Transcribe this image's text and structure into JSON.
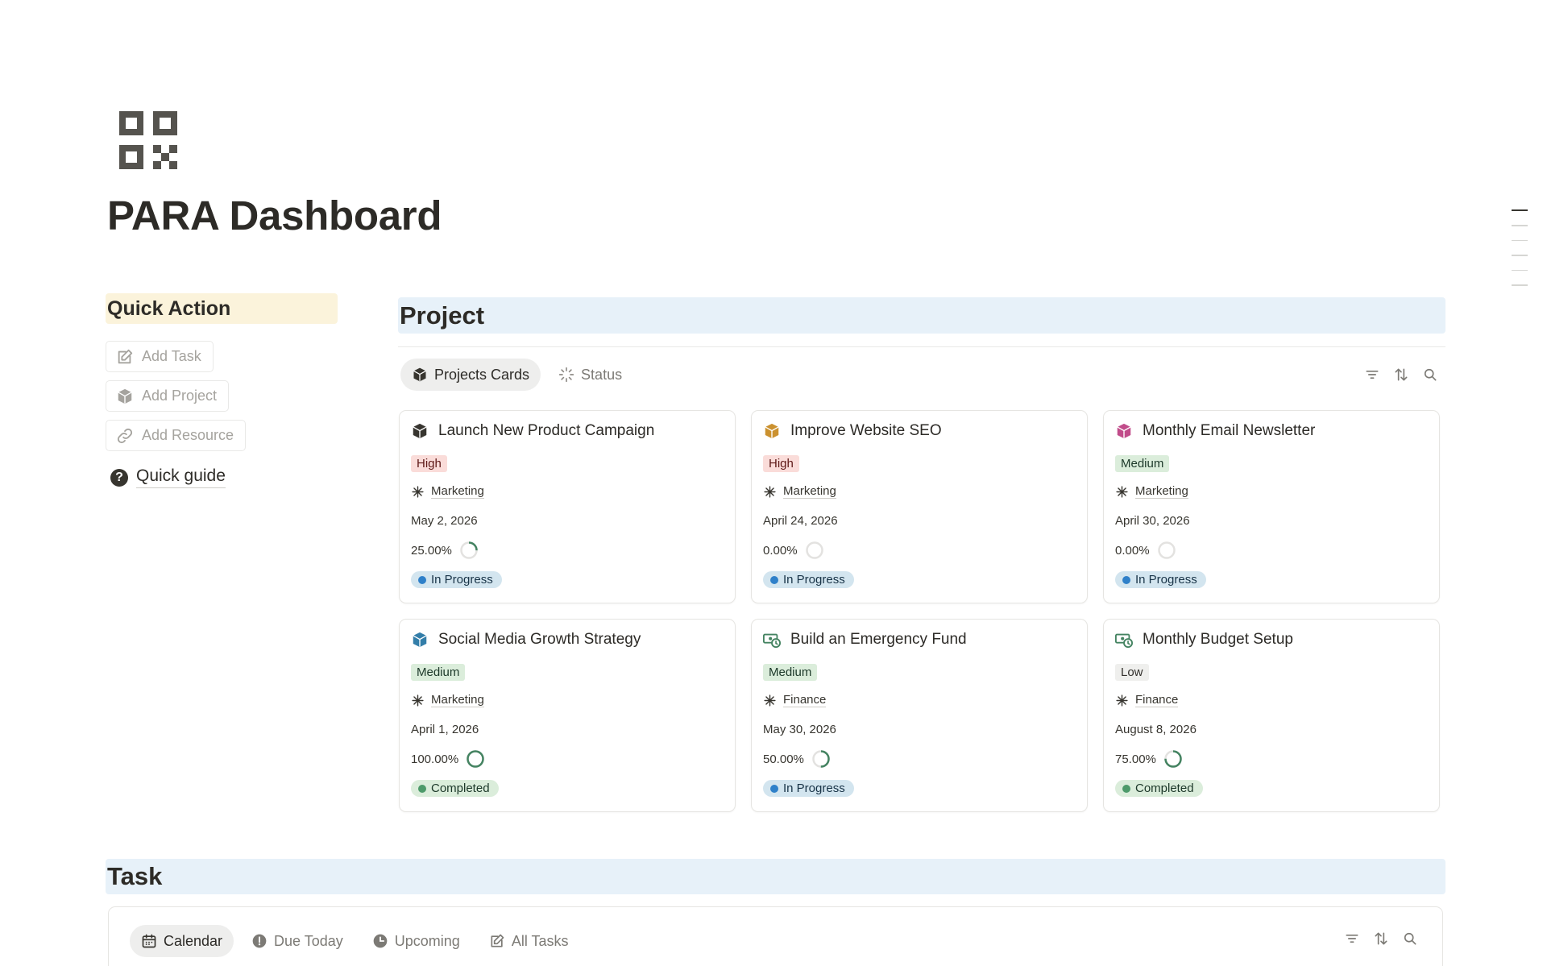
{
  "page": {
    "title": "PARA Dashboard",
    "icon": "qr-code-icon"
  },
  "quick_action": {
    "heading": "Quick Action",
    "buttons": [
      {
        "label": "Add Task",
        "icon": "edit-icon"
      },
      {
        "label": "Add Project",
        "icon": "cube-icon"
      },
      {
        "label": "Add Resource",
        "icon": "link-icon"
      }
    ],
    "guide": {
      "label": "Quick guide",
      "icon": "question-circle-icon"
    }
  },
  "project": {
    "heading": "Project",
    "tabs": [
      {
        "label": "Projects Cards",
        "icon": "cube-icon",
        "active": true
      },
      {
        "label": "Status",
        "icon": "loading-icon",
        "active": false
      }
    ],
    "tools": [
      "filter-icon",
      "sort-icon",
      "search-icon"
    ],
    "cards": [
      {
        "title": "Launch New Product Campaign",
        "icon_color": "#37352f",
        "priority": "High",
        "area": "Marketing",
        "date": "May 2, 2026",
        "progress": "25.00%",
        "progress_value": 0.25,
        "status": "In Progress"
      },
      {
        "title": "Improve Website SEO",
        "icon_color": "#cb912f",
        "priority": "High",
        "area": "Marketing",
        "date": "April 24, 2026",
        "progress": "0.00%",
        "progress_value": 0,
        "status": "In Progress"
      },
      {
        "title": "Monthly Email Newsletter",
        "icon_color": "#c14c8a",
        "priority": "Medium",
        "area": "Marketing",
        "date": "April 30, 2026",
        "progress": "0.00%",
        "progress_value": 0,
        "status": "In Progress"
      },
      {
        "title": "Social Media Growth Strategy",
        "icon_color": "#337ea9",
        "priority": "Medium",
        "area": "Marketing",
        "date": "April 1, 2026",
        "progress": "100.00%",
        "progress_value": 1,
        "status": "Completed"
      },
      {
        "title": "Build an Emergency Fund",
        "icon_color": "#448361",
        "priority": "Medium",
        "area": "Finance",
        "date": "May 30, 2026",
        "progress": "50.00%",
        "progress_value": 0.5,
        "status": "In Progress"
      },
      {
        "title": "Monthly Budget Setup",
        "icon_color": "#448361",
        "priority": "Low",
        "area": "Finance",
        "date": "August 8, 2026",
        "progress": "75.00%",
        "progress_value": 0.75,
        "status": "Completed"
      }
    ]
  },
  "task": {
    "heading": "Task",
    "tabs": [
      {
        "label": "Calendar",
        "icon": "calendar-icon",
        "active": true
      },
      {
        "label": "Due Today",
        "icon": "alert-circle-icon",
        "active": false
      },
      {
        "label": "Upcoming",
        "icon": "clock-icon",
        "active": false
      },
      {
        "label": "All Tasks",
        "icon": "edit-icon",
        "active": false
      }
    ],
    "tools": [
      "filter-icon",
      "sort-icon",
      "search-icon"
    ]
  },
  "colors": {
    "progress_ring": "#448361",
    "ring_track": "#e3e2e0",
    "heading_blue_bg": "#e7f1f9",
    "heading_yellow_bg": "#fbf3db"
  }
}
